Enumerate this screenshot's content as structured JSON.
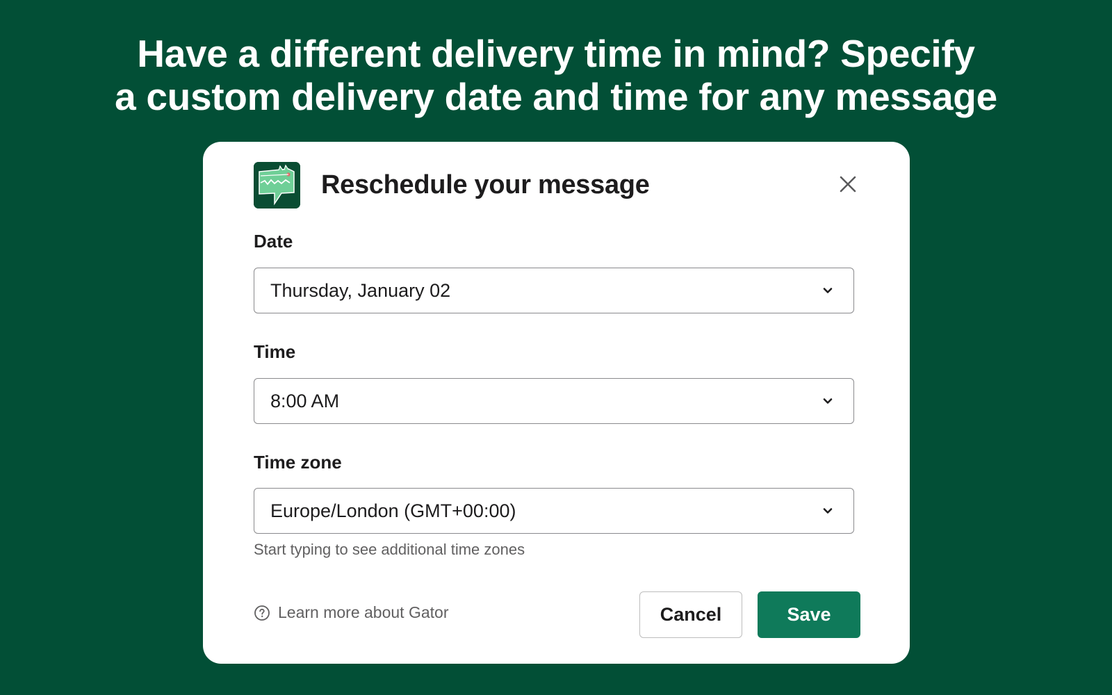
{
  "headline": {
    "line1": "Have a different delivery time in mind? Specify",
    "line2": "a custom delivery date and time for any message"
  },
  "modal": {
    "title": "Reschedule your message",
    "app_icon": "gator-chat-bubble-icon",
    "close_icon": "close-icon"
  },
  "fields": {
    "date": {
      "label": "Date",
      "value": "Thursday, January 02"
    },
    "time": {
      "label": "Time",
      "value": "8:00 AM"
    },
    "timezone": {
      "label": "Time zone",
      "value": "Europe/London (GMT+00:00)",
      "hint": "Start typing to see additional time zones"
    }
  },
  "footer": {
    "learn_more": "Learn more about Gator",
    "cancel": "Cancel",
    "save": "Save"
  },
  "colors": {
    "background": "#024f36",
    "save_button": "#0f7a5a",
    "icon_green": "#0a4d33",
    "icon_mint": "#6fcf97"
  }
}
